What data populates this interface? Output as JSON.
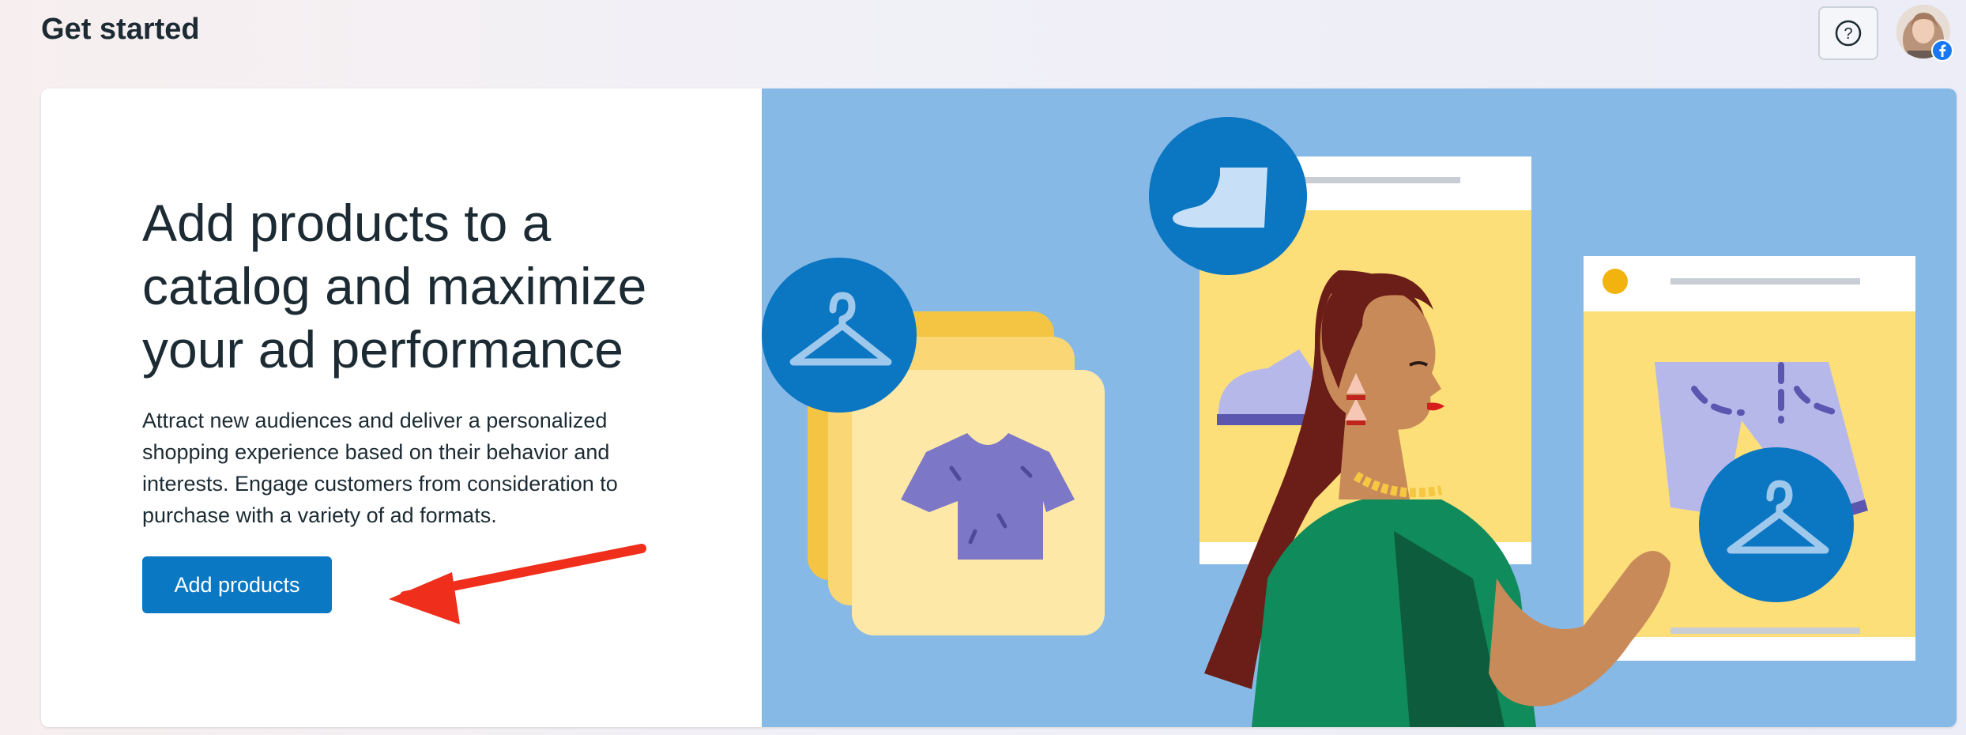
{
  "header": {
    "title": "Get started",
    "help_icon": "question-circle-icon",
    "avatar_badge_icon": "facebook-icon"
  },
  "hero": {
    "headline": "Add products to a catalog and maximize your ad performance",
    "description": "Attract new audiences and deliver a personalized shopping experience based on their behavior and interests. Engage customers from consideration to purchase with a variety of ad formats.",
    "cta_label": "Add products"
  },
  "colors": {
    "primary": "#0a78c3",
    "illustration_bg": "#86b9e6",
    "annotation_arrow": "#ef2e1c",
    "card_yellow": "#fddf7a",
    "circle_blue": "#0b76c2"
  }
}
